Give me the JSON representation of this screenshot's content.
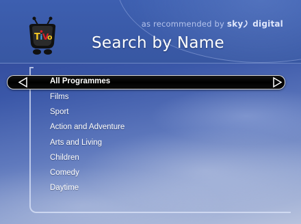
{
  "header": {
    "recommended_prefix": "as recommended by",
    "brand_sky": "sky",
    "brand_digital": "digital",
    "title": "Search by Name",
    "logo_icon": "tivo-logo-icon"
  },
  "menu": {
    "selected_index": 0,
    "items": [
      {
        "label": "All Programmes"
      },
      {
        "label": "Films"
      },
      {
        "label": "Sport"
      },
      {
        "label": "Action and Adventure"
      },
      {
        "label": "Arts and Living"
      },
      {
        "label": "Children"
      },
      {
        "label": "Comedy"
      },
      {
        "label": "Daytime"
      }
    ],
    "left_arrow_icon": "left-arrow-icon",
    "right_arrow_icon": "right-arrow-icon"
  },
  "colors": {
    "header": "#3a5aa8",
    "selection": "#000000",
    "text": "#ffffff",
    "tivo_red": "#d8202a",
    "tivo_yellow": "#f3c623"
  }
}
